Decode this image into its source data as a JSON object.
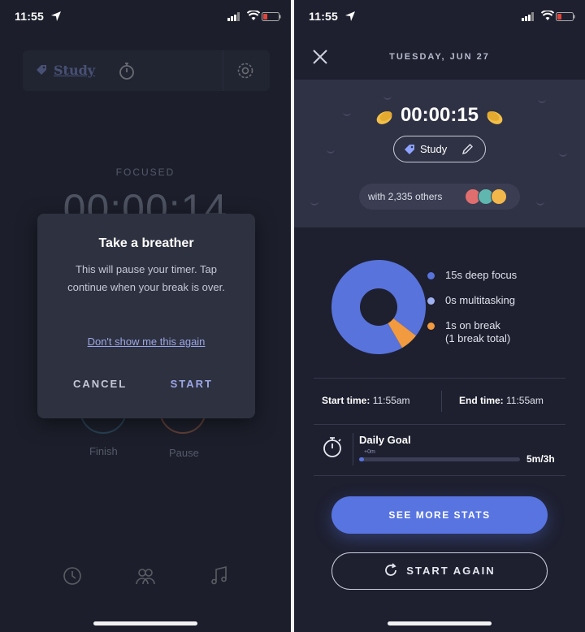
{
  "left_screen": {
    "status_time": "11:55",
    "topbar": {
      "tag_label": "Study"
    },
    "focused_label": "FOCUSED",
    "timer": "00:00:14",
    "finish_label": "Finish",
    "pause_label": "Pause",
    "modal": {
      "title": "Take a breather",
      "body": "This will pause your timer. Tap continue when your break is over.",
      "link": "Don't show me this again",
      "cancel": "CANCEL",
      "start": "START"
    }
  },
  "right_screen": {
    "status_time": "11:55",
    "date": "TUESDAY, JUN 27",
    "session_timer": "00:00:15",
    "tag_label": "Study",
    "others_label": "with 2,335 others",
    "breakdown": [
      {
        "label": "15s deep focus",
        "seconds": 15,
        "color": "#5873db"
      },
      {
        "label": "0s multitasking",
        "seconds": 0,
        "color": "#9fb1ef"
      },
      {
        "label": "1s on break",
        "sublabel": "(1 break total)",
        "seconds": 1,
        "color": "#f29a3f"
      }
    ],
    "start_time_label": "Start time:",
    "start_time": "11:55am",
    "end_time_label": "End time:",
    "end_time": "11:55am",
    "daily_goal": {
      "title": "Daily Goal",
      "progress_marker": "+0m",
      "value": "5m/3h",
      "fraction": 0.028
    },
    "see_more_button": "SEE MORE STATS",
    "start_again_button": "START AGAIN"
  },
  "colors": {
    "accent": "#5774e0",
    "background": "#1e2030",
    "hero": "#2f3244"
  }
}
